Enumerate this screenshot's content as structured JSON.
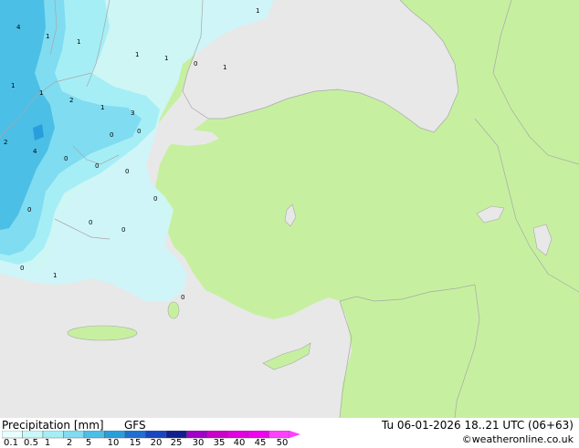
{
  "title_left": "Precipitation [mm]",
  "model": "GFS",
  "valid_time": "Tu 06-01-2026 18..21 UTC (06+63)",
  "credit": "©weatheronline.co.uk",
  "legend": {
    "values": [
      "0.1",
      "0.5",
      "1",
      "2",
      "5",
      "10",
      "15",
      "20",
      "25",
      "30",
      "35",
      "40",
      "45",
      "50"
    ],
    "colors": [
      "#e6ffff",
      "#c8f8fa",
      "#a6eef6",
      "#80dcf0",
      "#4cbfe6",
      "#2a9edc",
      "#1f6ed2",
      "#1a44c0",
      "#121e8c",
      "#a000c8",
      "#c800c8",
      "#e000e0",
      "#f000f0",
      "#ff40ff"
    ]
  },
  "map_labels": [
    "1",
    "4",
    "1",
    "1",
    "1",
    "2",
    "2",
    "1",
    "3",
    "4",
    "1",
    "0",
    "1",
    "1",
    "1",
    "0",
    "1",
    "0",
    "0",
    "0",
    "0",
    "0",
    "0",
    "0",
    "0",
    "0",
    "0"
  ],
  "colors": {
    "land": "#c6f0a0",
    "sea": "#e8e8e8",
    "border": "#a8a8a8"
  }
}
